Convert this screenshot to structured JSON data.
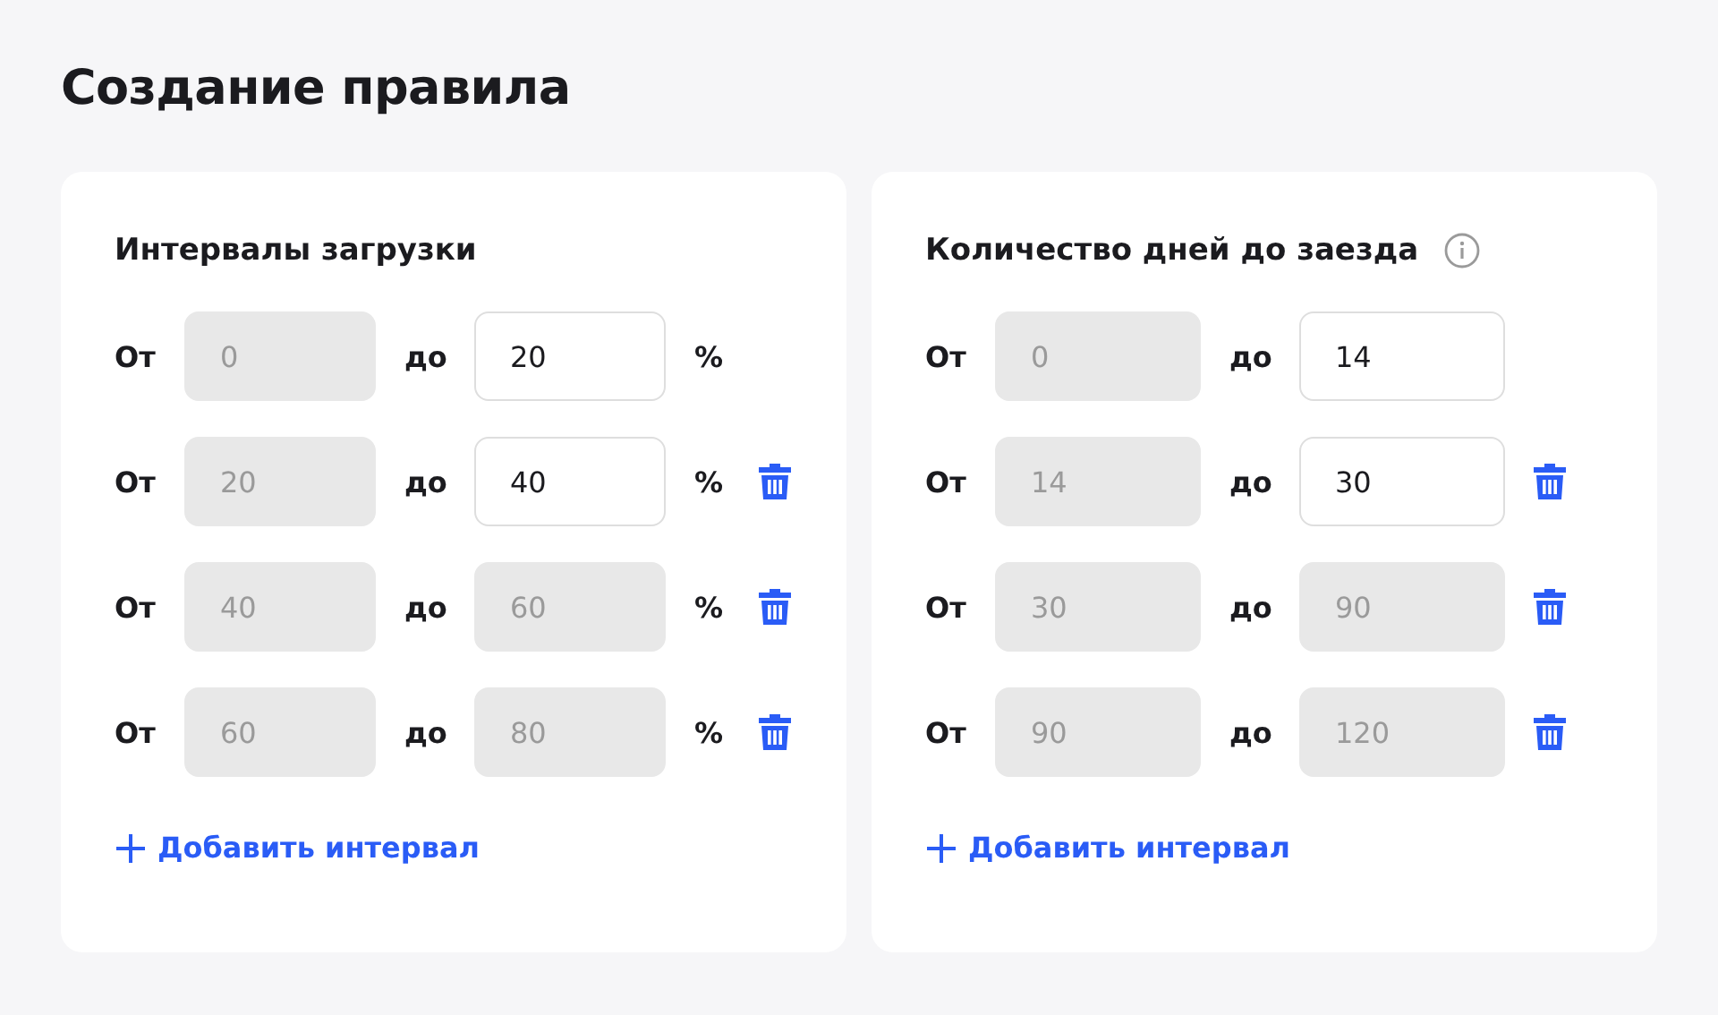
{
  "title": "Создание правила",
  "cards": [
    {
      "heading": "Интервалы загрузки",
      "info": false,
      "rows": [
        {
          "from_label": "От",
          "from": {
            "value": "0",
            "disabled": true
          },
          "to_label": "до",
          "to": {
            "value": "20",
            "disabled": false
          },
          "unit": "%",
          "removable": false
        },
        {
          "from_label": "От",
          "from": {
            "value": "20",
            "disabled": true
          },
          "to_label": "до",
          "to": {
            "value": "40",
            "disabled": false
          },
          "unit": "%",
          "removable": true
        },
        {
          "from_label": "От",
          "from": {
            "value": "40",
            "disabled": true
          },
          "to_label": "до",
          "to": {
            "value": "60",
            "disabled": true
          },
          "unit": "%",
          "removable": true
        },
        {
          "from_label": "От",
          "from": {
            "value": "60",
            "disabled": true
          },
          "to_label": "до",
          "to": {
            "value": "80",
            "disabled": true
          },
          "unit": "%",
          "removable": true
        }
      ],
      "add_button": "Добавить интервал"
    },
    {
      "heading": "Количество дней до заезда",
      "info": true,
      "rows": [
        {
          "from_label": "От",
          "from": {
            "value": "0",
            "disabled": true
          },
          "to_label": "до",
          "to": {
            "value": "14",
            "disabled": false
          },
          "removable": false
        },
        {
          "from_label": "От",
          "from": {
            "value": "14",
            "disabled": true
          },
          "to_label": "до",
          "to": {
            "value": "30",
            "disabled": false
          },
          "removable": true
        },
        {
          "from_label": "От",
          "from": {
            "value": "30",
            "disabled": true
          },
          "to_label": "до",
          "to": {
            "value": "90",
            "disabled": true
          },
          "removable": true
        },
        {
          "from_label": "От",
          "from": {
            "value": "90",
            "disabled": true
          },
          "to_label": "до",
          "to": {
            "value": "120",
            "disabled": true
          },
          "removable": true
        }
      ],
      "add_button": "Добавить интервал"
    }
  ]
}
